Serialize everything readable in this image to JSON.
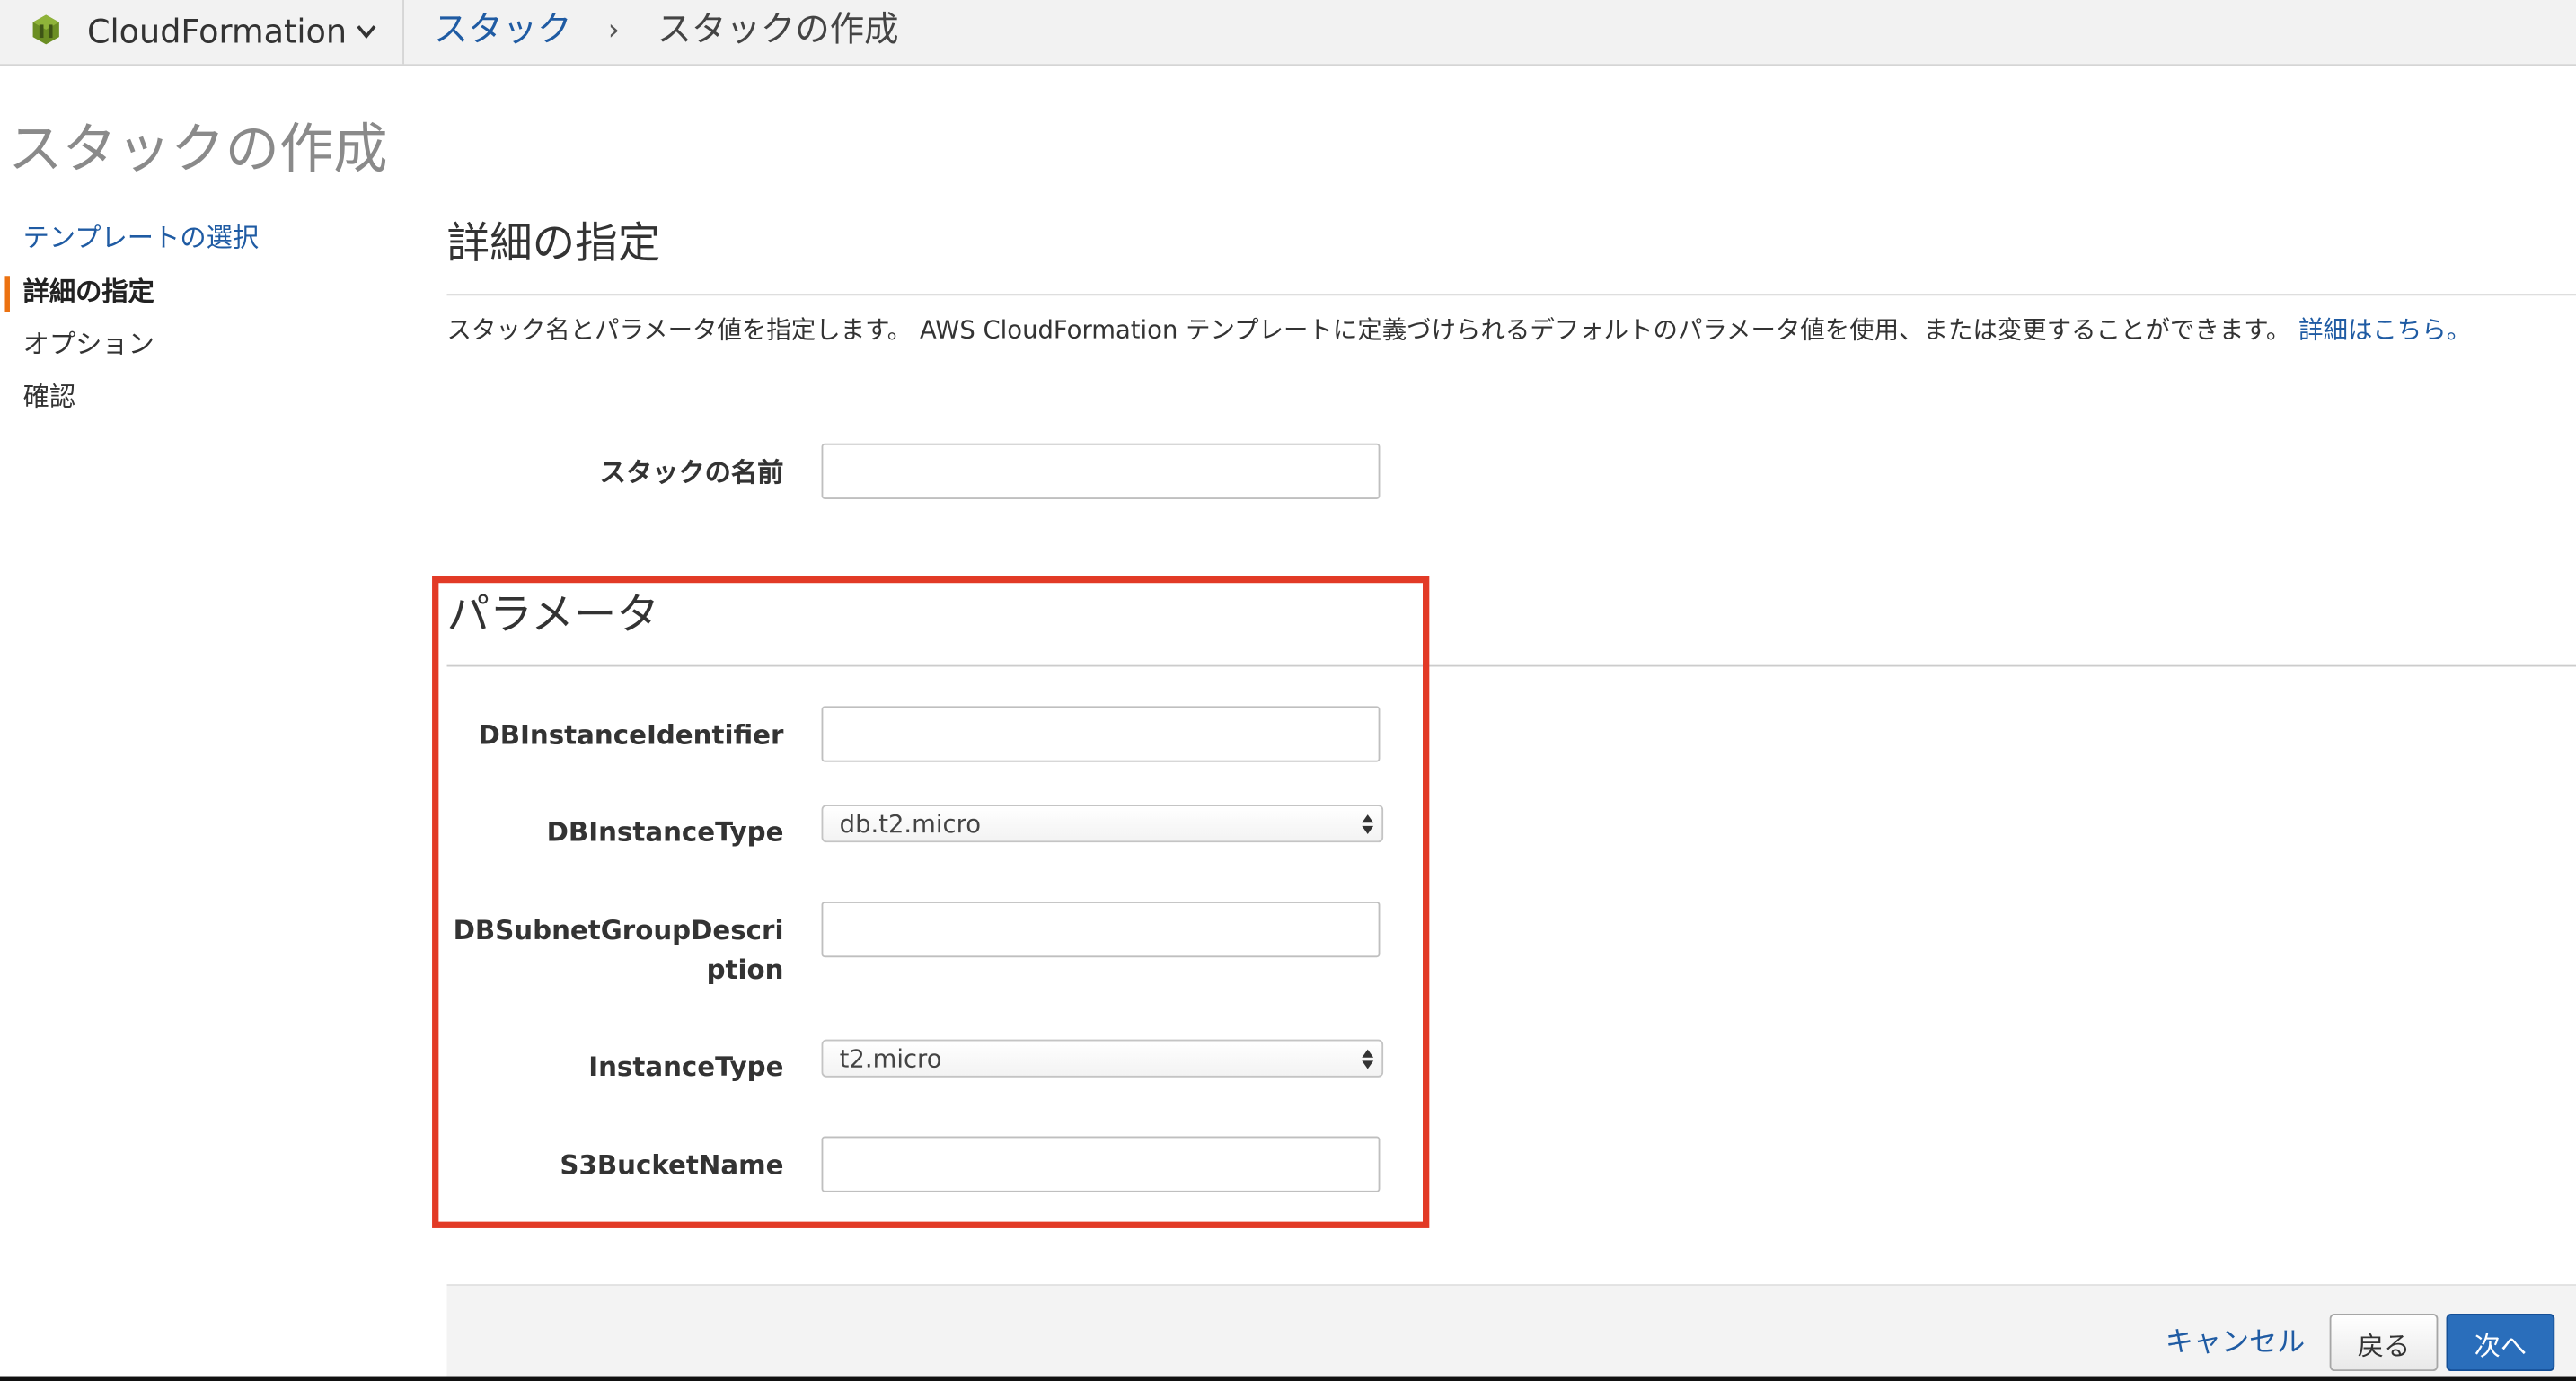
{
  "topbar": {
    "service_name": "CloudFormation",
    "breadcrumb_link": "スタック",
    "breadcrumb_separator": "›",
    "breadcrumb_current": "スタックの作成"
  },
  "page": {
    "title": "スタックの作成"
  },
  "wizard": {
    "steps": [
      {
        "label": "テンプレートの選択",
        "state": "link"
      },
      {
        "label": "詳細の指定",
        "state": "active"
      },
      {
        "label": "オプション",
        "state": "pending"
      },
      {
        "label": "確認",
        "state": "pending"
      }
    ]
  },
  "details": {
    "title": "詳細の指定",
    "description": "スタック名とパラメータ値を指定します。 AWS CloudFormation テンプレートに定義づけられるデフォルトのパラメータ値を使用、または変更することができます。",
    "more_link": "詳細はこちら。",
    "stack_name_label": "スタックの名前",
    "stack_name_value": ""
  },
  "parameters": {
    "title": "パラメータ",
    "fields": {
      "db_instance_identifier": {
        "label": "DBInstanceIdentifier",
        "value": ""
      },
      "db_instance_type": {
        "label": "DBInstanceType",
        "value": "db.t2.micro"
      },
      "db_subnet_group_description": {
        "label": "DBSubnetGroupDescription",
        "value": ""
      },
      "instance_type": {
        "label": "InstanceType",
        "value": "t2.micro"
      },
      "s3_bucket_name": {
        "label": "S3BucketName",
        "value": ""
      }
    }
  },
  "footer": {
    "cancel_label": "キャンセル",
    "back_label": "戻る",
    "next_label": "次へ"
  },
  "colors": {
    "link": "#1f5ba3",
    "active_step_accent": "#ec7211",
    "primary_button": "#2a6ebb",
    "highlight_border": "#e23a26"
  },
  "icons": {
    "service": "cloudformation-logo-icon",
    "service_menu": "chevron-down-icon",
    "select": "select-arrows-icon"
  }
}
